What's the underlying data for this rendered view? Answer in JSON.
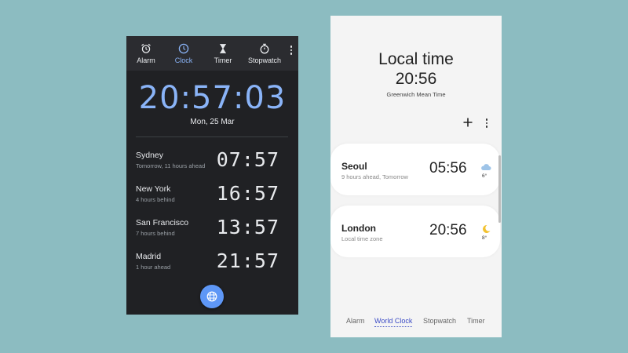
{
  "left_app": {
    "tabs": [
      {
        "label": "Alarm",
        "icon": "alarm-icon"
      },
      {
        "label": "Clock",
        "icon": "clock-icon"
      },
      {
        "label": "Timer",
        "icon": "hourglass-icon"
      },
      {
        "label": "Stopwatch",
        "icon": "stopwatch-icon"
      }
    ],
    "active_tab": "Clock",
    "current_time": "20:57:03",
    "current_date": "Mon, 25 Mar",
    "cities": [
      {
        "name": "Sydney",
        "offset": "Tomorrow, 11 hours ahead",
        "time": "07:57"
      },
      {
        "name": "New York",
        "offset": "4 hours behind",
        "time": "16:57"
      },
      {
        "name": "San Francisco",
        "offset": "7 hours behind",
        "time": "13:57"
      },
      {
        "name": "Madrid",
        "offset": "1 hour ahead",
        "time": "21:57"
      }
    ],
    "fab_icon": "globe-icon",
    "colors": {
      "background": "#202124",
      "accent": "#8ab4f8",
      "fab": "#5e97f6"
    }
  },
  "right_app": {
    "title": "Local time",
    "local_time": "20:56",
    "time_zone": "Greenwich Mean Time",
    "cities": [
      {
        "name": "Seoul",
        "offset": "9 hours ahead, Tomorrow",
        "time": "05:56",
        "weather_icon": "cloud-icon",
        "temp": "6°"
      },
      {
        "name": "London",
        "offset": "Local time zone",
        "time": "20:56",
        "weather_icon": "moon-icon",
        "temp": "8°"
      }
    ],
    "tabs": [
      {
        "label": "Alarm"
      },
      {
        "label": "World Clock"
      },
      {
        "label": "Stopwatch"
      },
      {
        "label": "Timer"
      }
    ],
    "active_tab": "World Clock",
    "colors": {
      "background": "#f4f4f4",
      "accent": "#3b4bc5"
    }
  }
}
